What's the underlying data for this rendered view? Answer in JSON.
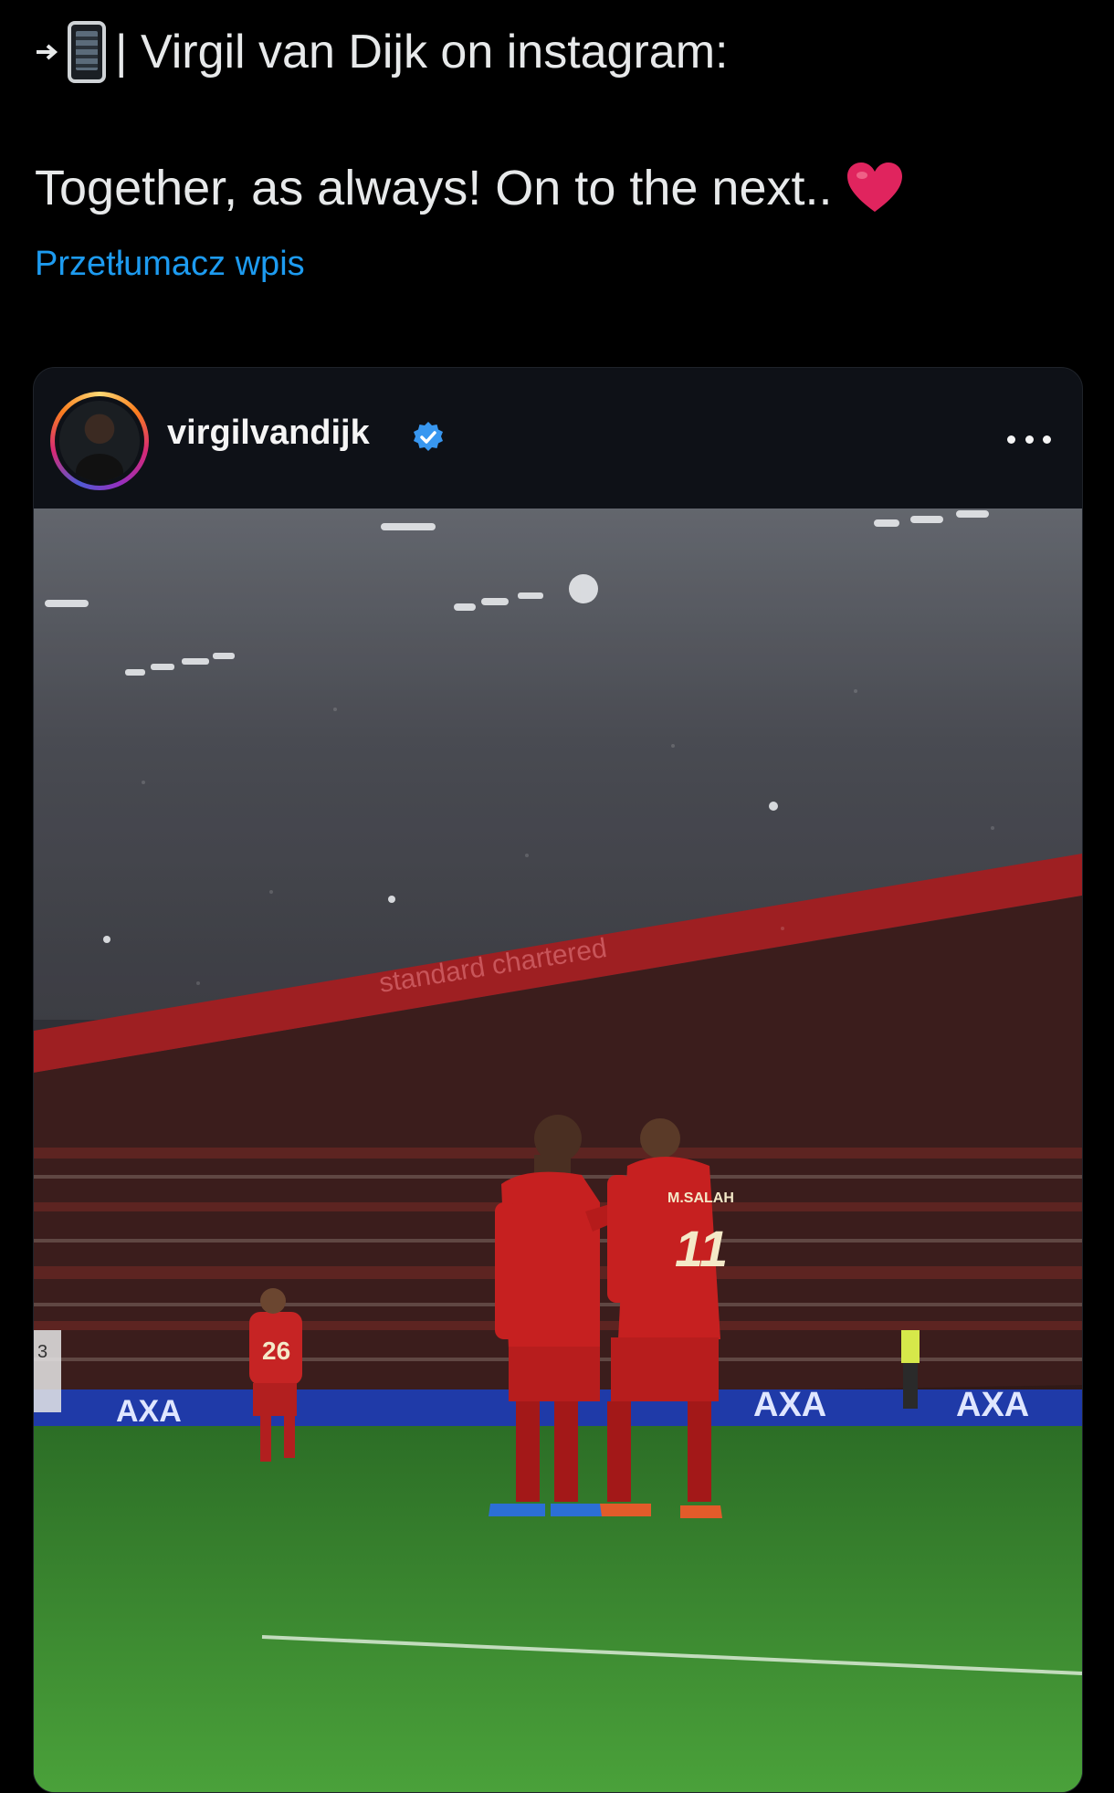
{
  "tweet": {
    "header_text": "| Virgil van Dijk on instagram:",
    "body_text": "Together, as always! On to the next..",
    "translate_label": "Przetłumacz wpis"
  },
  "instagram": {
    "username": "virgilvandijk",
    "verified": true,
    "photo_texts": {
      "banner_sponsor": "standard chartered",
      "board_text": "AXA",
      "jersey_name": "M.SALAH",
      "jersey_number": "11",
      "other_number": "26",
      "crowd_left_number": "3"
    }
  },
  "icons": {
    "phone": "mobile-arrow-icon",
    "heart": "red-heart-icon",
    "verified": "verified-badge-icon",
    "more": "more-horizontal-icon"
  },
  "colors": {
    "link": "#1d9bf0",
    "heart": "#e0245e",
    "verified": "#3897f0"
  }
}
